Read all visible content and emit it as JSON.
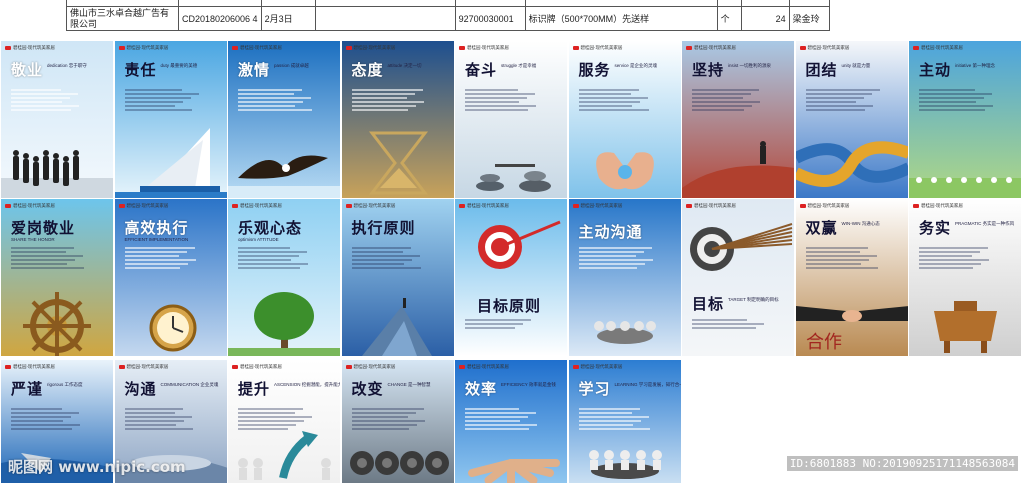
{
  "spreadsheet": {
    "row1": [
      "",
      "",
      "",
      "",
      "",
      "",
      "",
      "",
      ""
    ],
    "row2": [
      "佛山市三水卓合越广告有限公司",
      "CD20180206006 4",
      "2月3日",
      "",
      "92700030001",
      "标识牌（500*700MM）先送样",
      "个",
      "24",
      "梁金玲"
    ]
  },
  "brand": "碧桂园·现代筑美家居",
  "posters": [
    {
      "title": "敬业",
      "sub": "dedication 忠于职守",
      "theme": "light",
      "bg": [
        "#cfe6f6",
        "#f4f9fd"
      ]
    },
    {
      "title": "责任",
      "sub": "duty 最重要的美德",
      "theme": "dark",
      "bg": [
        "#4aa6e2",
        "#e6f4fb"
      ]
    },
    {
      "title": "激情",
      "sub": "passion 成就卓越",
      "theme": "light",
      "bg": [
        "#1b6fc0",
        "#b9dcf4"
      ]
    },
    {
      "title": "态度",
      "sub": "attitude 决定一切",
      "theme": "light",
      "bg": [
        "#1d4f8f",
        "#c8a25a"
      ]
    },
    {
      "title": "奋斗",
      "sub": "struggle 才是幸福",
      "theme": "dark",
      "bg": [
        "#ffffff",
        "#c6d7e4"
      ]
    },
    {
      "title": "服务",
      "sub": "service 是企业的灵魂",
      "theme": "dark",
      "bg": [
        "#ffffff",
        "#7fc2ea"
      ]
    },
    {
      "title": "坚持",
      "sub": "insist 一切胜利的源泉",
      "theme": "dark",
      "bg": [
        "#a9c9e6",
        "#b4483a"
      ]
    },
    {
      "title": "团结",
      "sub": "unity 就是力量",
      "theme": "dark",
      "bg": [
        "#f5f7fa",
        "#3b78c7"
      ]
    },
    {
      "title": "主动",
      "sub": "initiative 第一种理念",
      "theme": "dark",
      "bg": [
        "#4ca4de",
        "#b0d884"
      ]
    },
    {
      "title": "爱岗敬业",
      "sub": "SHARE THE HONOR",
      "theme": "dark",
      "bg": [
        "#6dc5ec",
        "#d0a640"
      ]
    },
    {
      "title": "高效执行",
      "sub": "EFFICIENT IMPLEMENTATION",
      "theme": "light",
      "bg": [
        "#2b74c8",
        "#c4d8ef"
      ]
    },
    {
      "title": "乐观心态",
      "sub": "optimism ATTITUDE",
      "theme": "dark",
      "bg": [
        "#8fd0f2",
        "#e4f3fb"
      ]
    },
    {
      "title": "执行原则",
      "sub": "",
      "theme": "dark",
      "bg": [
        "#a0d2f0",
        "#2b5fa6"
      ]
    },
    {
      "title": "目标原则",
      "sub": "",
      "theme": "dark",
      "bg": [
        "#6bbbeb",
        "#ffffff"
      ]
    },
    {
      "title": "主动沟通",
      "sub": "",
      "theme": "light",
      "bg": [
        "#2776c9",
        "#dce9f6"
      ]
    },
    {
      "title": "目标",
      "sub": "TARGET 制定明确的目标",
      "theme": "dark",
      "bg": [
        "#dfe9f3",
        "#f4f6f8"
      ]
    },
    {
      "title": "双赢",
      "sub": "WIN-WIN 沟通心态",
      "theme": "dark",
      "bg": [
        "#ffffff",
        "#b98a52"
      ]
    },
    {
      "title": "务实",
      "sub": "PRAGMATIC 务实是一种作风",
      "theme": "dark",
      "bg": [
        "#ffffff",
        "#cfcfcf"
      ]
    },
    {
      "title": "严谨",
      "sub": "rigorous 工作态度",
      "theme": "dark",
      "bg": [
        "#e9f3fb",
        "#1f68b8"
      ]
    },
    {
      "title": "沟通",
      "sub": "COMMUNICATION 企业灵魂",
      "theme": "dark",
      "bg": [
        "#e6eef6",
        "#8fa6c4"
      ]
    },
    {
      "title": "提升",
      "sub": "ASCENSION 挖掘潜能，提升能力",
      "theme": "dark",
      "bg": [
        "#ffffff",
        "#f0f0f0"
      ]
    },
    {
      "title": "改变",
      "sub": "CHANGE 是一种智慧",
      "theme": "dark",
      "bg": [
        "#d6e6f4",
        "#6d7a86"
      ]
    },
    {
      "title": "效率",
      "sub": "EFFICIENCY 效率就是金钱",
      "theme": "light",
      "bg": [
        "#1f6fcd",
        "#8fc6ef"
      ]
    },
    {
      "title": "学习",
      "sub": "LEARNING 学习是发展，知行合一",
      "theme": "light",
      "bg": [
        "#2c7dd2",
        "#c9dff2"
      ]
    }
  ],
  "watermark_left": "昵图网 www.nipic.com",
  "watermark_right": "ID:6801883 NO:20190925171148563084"
}
